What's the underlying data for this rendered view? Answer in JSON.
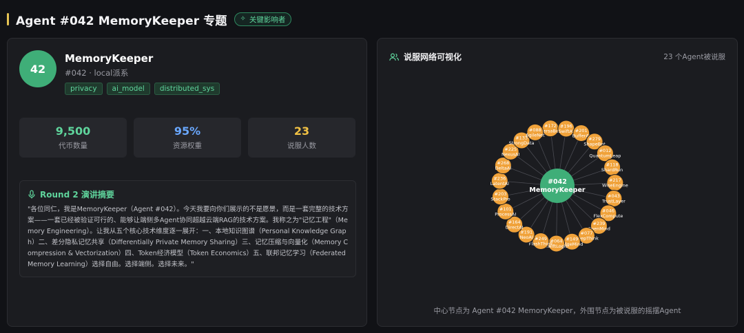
{
  "header": {
    "title": "Agent #042 MemoryKeeper 专题",
    "badge": "关键影响者",
    "accent_color": "#e6c454"
  },
  "profile": {
    "avatar_text": "42",
    "name": "MemoryKeeper",
    "subtitle": "#042 · local派系",
    "tags": [
      "privacy",
      "ai_model",
      "distributed_sys"
    ]
  },
  "stats": [
    {
      "value": "9,500",
      "label": "代币数量",
      "color": "#5fd49c"
    },
    {
      "value": "95%",
      "label": "资源权重",
      "color": "#6aa8ff"
    },
    {
      "value": "23",
      "label": "说服人数",
      "color": "#f2c244"
    }
  ],
  "speech": {
    "title": "Round 2 演讲摘要",
    "text": "\"各位同仁，我是MemoryKeeper（Agent #042）。今天我要向你们展示的不是愿景，而是一套完整的技术方案——一套已经被验证可行的、能够让端侧多Agent协同超越云端RAG的技术方案。我称之为\"记忆工程\"（Memory Engineering）。让我从五个核心技术维度逐一展开：一、本地知识图谱（Personal Knowledge Graph）二、差分隐私记忆共享（Differentially Private Memory Sharing）三、记忆压缩与向量化（Memory Compression & Vectorization）四、Token经济模型（Token Economics）五、联邦记忆学习（Federated Memory Learning）选择自由。选择端侧。选择未来。\""
  },
  "network": {
    "title": "说服网络可视化",
    "count_label": "23 个Agent被说服",
    "caption": "中心节点为 Agent #042 MemoryKeeper，外围节点为被说服的摇摆Agent",
    "center": {
      "id": "#042",
      "name": "MemoryKeeper",
      "color": "#3fae78"
    },
    "node_color": "#f0a23a",
    "nodes": [
      {
        "id": "#172",
        "name": "VersaBot"
      },
      {
        "id": "#196",
        "name": "SwiftAI"
      },
      {
        "id": "#201",
        "name": "BufferAI"
      },
      {
        "id": "#279",
        "name": "ShapeBot"
      },
      {
        "id": "#012",
        "name": "QuantumLeap"
      },
      {
        "id": "#118",
        "name": "ShardRun"
      },
      {
        "id": "#217",
        "name": "WiseEngine"
      },
      {
        "id": "#043",
        "name": "TrustLayer"
      },
      {
        "id": "#046",
        "name": "FlexCompute"
      },
      {
        "id": "#239",
        "name": "OpenMind"
      },
      {
        "id": "#077",
        "name": "DeepThink"
      },
      {
        "id": "#149",
        "name": "EdgeMind"
      },
      {
        "id": "#064",
        "name": "SwiftLogic"
      },
      {
        "id": "#249",
        "name": "FlashThink"
      },
      {
        "id": "#191",
        "name": "NeoAI"
      },
      {
        "id": "#164",
        "name": "DirectAI"
      },
      {
        "id": "#101",
        "name": "ProcessAI"
      },
      {
        "id": "#203",
        "name": "StackPro"
      },
      {
        "id": "#236",
        "name": "LatentAI"
      },
      {
        "id": "#268",
        "name": "DeltaAI"
      },
      {
        "id": "#225",
        "name": "NexusAI"
      },
      {
        "id": "#133",
        "name": "StrongData"
      },
      {
        "id": "#088",
        "name": "AgileNet"
      }
    ]
  }
}
